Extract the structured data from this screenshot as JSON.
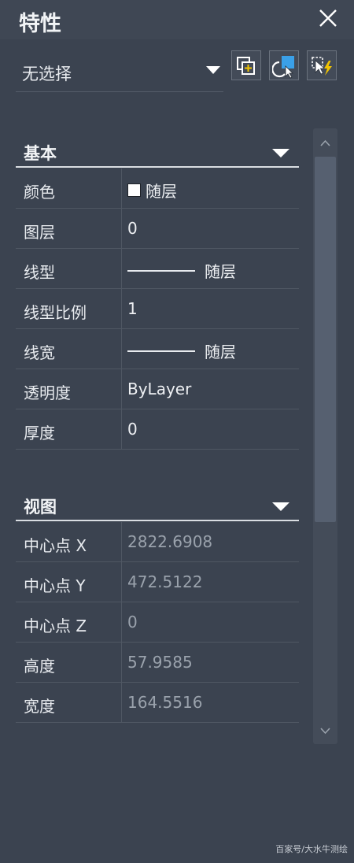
{
  "window": {
    "title": "特性"
  },
  "selection": {
    "value": "无选择"
  },
  "sections": {
    "basic": {
      "label": "基本",
      "rows": [
        {
          "name": "颜色",
          "value": "随层"
        },
        {
          "name": "图层",
          "value": "0"
        },
        {
          "name": "线型",
          "value": "随层"
        },
        {
          "name": "线型比例",
          "value": "1"
        },
        {
          "name": "线宽",
          "value": "随层"
        },
        {
          "name": "透明度",
          "value": "ByLayer"
        },
        {
          "name": "厚度",
          "value": "0"
        }
      ]
    },
    "view": {
      "label": "视图",
      "rows": [
        {
          "name": "中心点 X",
          "value": "2822.6908"
        },
        {
          "name": "中心点 Y",
          "value": "472.5122"
        },
        {
          "name": "中心点 Z",
          "value": "0"
        },
        {
          "name": "高度",
          "value": "57.9585"
        },
        {
          "name": "宽度",
          "value": "164.5516"
        }
      ]
    }
  },
  "watermark": "百家号/大水牛测绘",
  "colors": {
    "panel_bg": "#3b4350",
    "accent_blue": "#3aa0e8",
    "accent_yellow": "#f2c400"
  },
  "icons": {
    "close": "close-icon",
    "dropdown": "chevron-down-icon",
    "quick_select": "quick-select-icon",
    "toggle_pickadd": "pickadd-icon",
    "select_objects": "select-objects-icon"
  }
}
